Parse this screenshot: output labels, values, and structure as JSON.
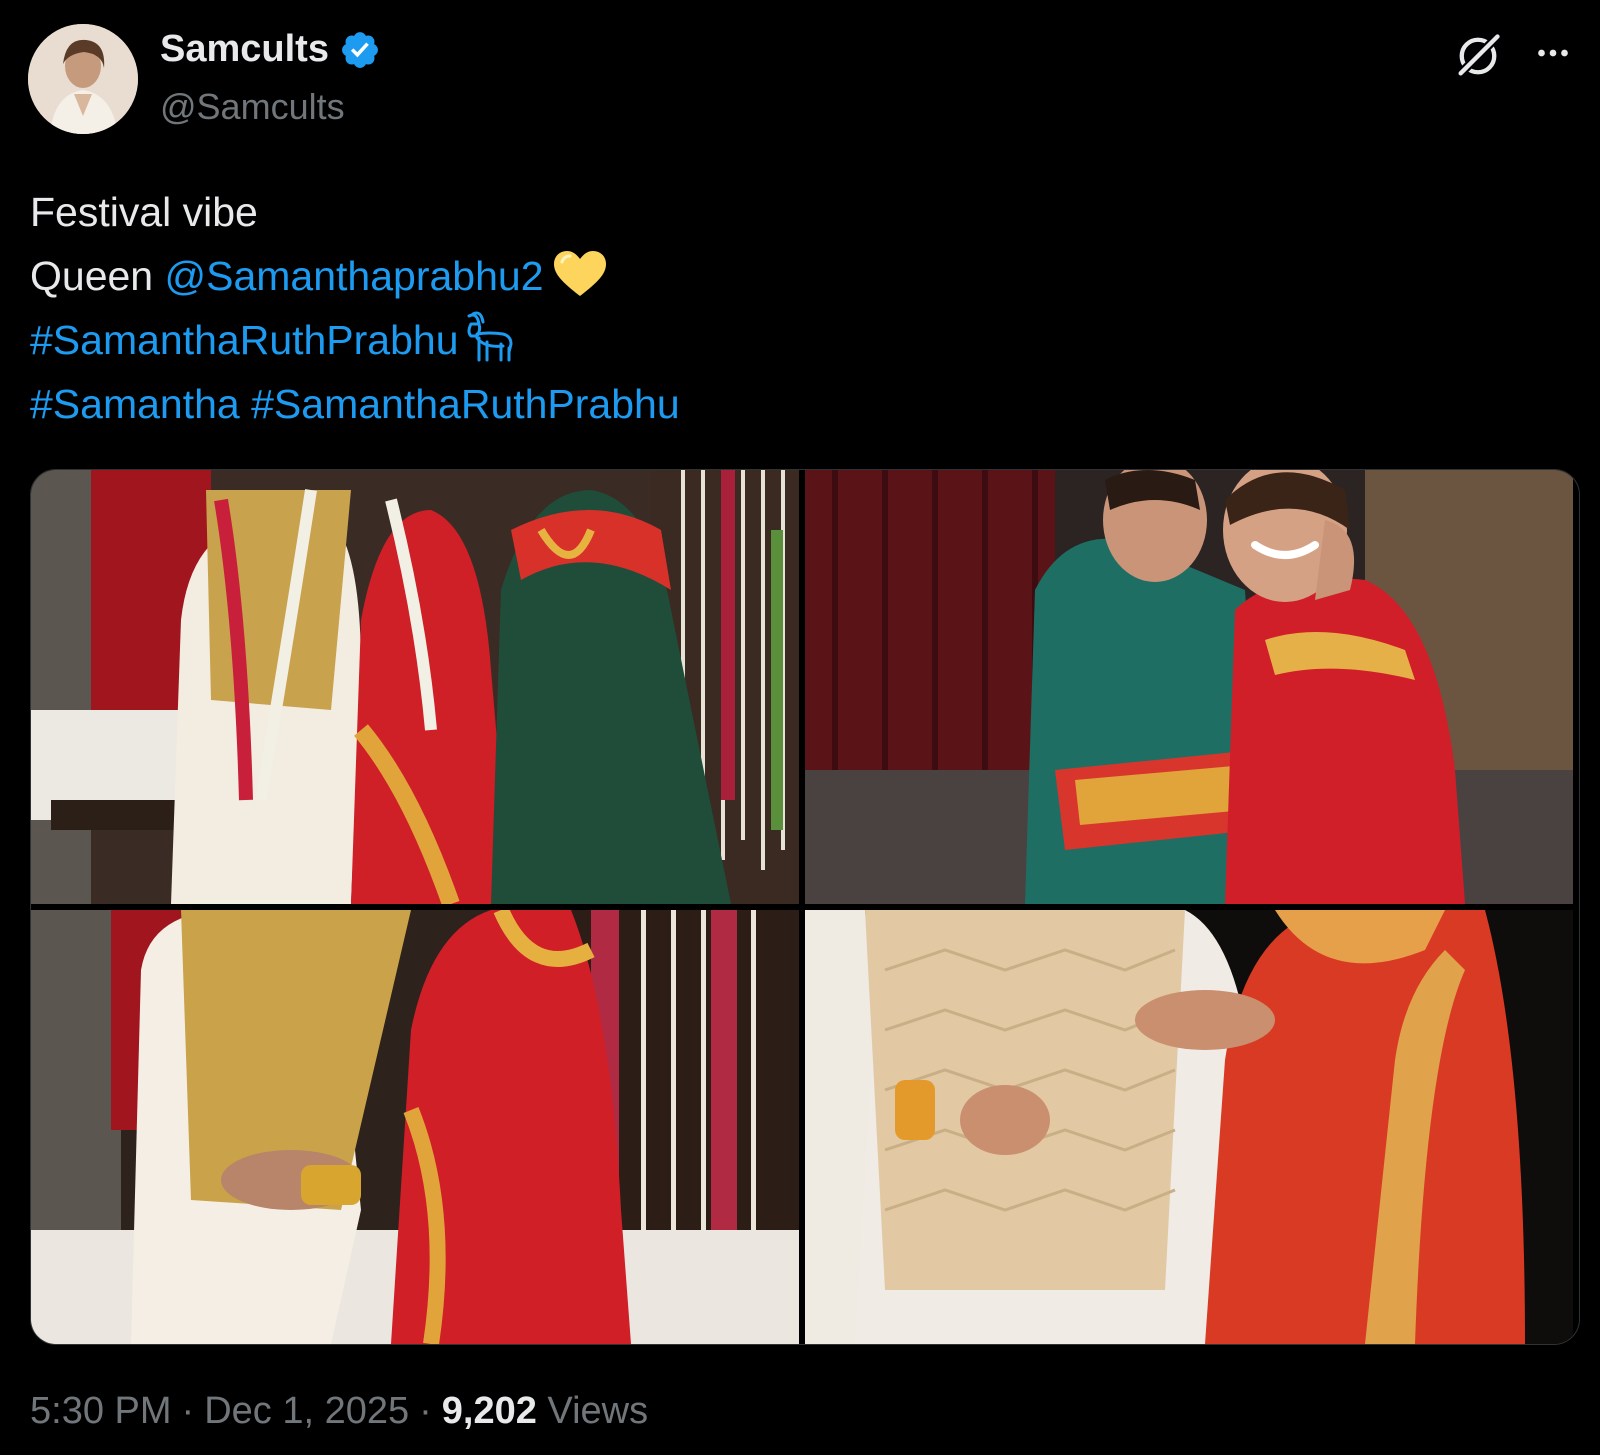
{
  "author": {
    "display_name": "Samcults",
    "handle": "@Samcults",
    "verified": true
  },
  "tweet": {
    "line1": "Festival vibe",
    "line2_prefix": "Queen ",
    "mention": "@Samanthaprabhu2",
    "hashtag_line3": "#SamanthaRuthPrabhu",
    "hashtag_line4a": "#Samantha",
    "hashtag_line4b": "#SamanthaRuthPrabhu"
  },
  "emojis": [
    "yellow-heart",
    "goat"
  ],
  "media": {
    "count": 4,
    "photos": [
      {
        "description_icon": "photo-couple-seated-garlands"
      },
      {
        "description_icon": "photo-women-embrace"
      },
      {
        "description_icon": "photo-couple-hands-closeup"
      },
      {
        "description_icon": "photo-couple-walking"
      }
    ]
  },
  "meta": {
    "time": "5:30 PM",
    "dot1": "·",
    "date": "Dec 1, 2025",
    "dot2": "·",
    "views_count": "9,202",
    "views_label": "Views"
  },
  "colors": {
    "background": "#000000",
    "text": "#e7e9ea",
    "secondary": "#71767b",
    "link": "#1d9bf0",
    "verified": "#1d9bf0"
  }
}
